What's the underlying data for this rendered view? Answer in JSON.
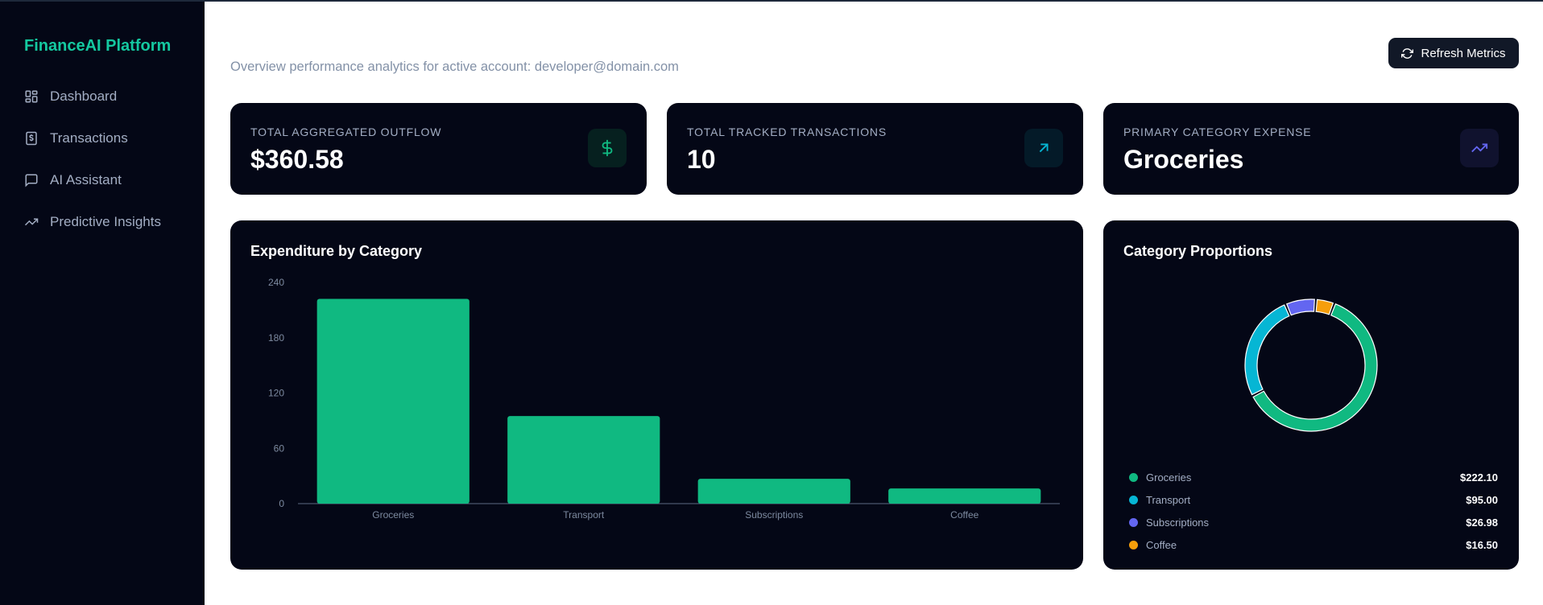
{
  "sidebar": {
    "brand": "FinanceAI Platform",
    "items": [
      {
        "label": "Dashboard",
        "icon": "dashboard-grid-icon"
      },
      {
        "label": "Transactions",
        "icon": "receipt-dollar-icon"
      },
      {
        "label": "AI Assistant",
        "icon": "chat-bubble-icon"
      },
      {
        "label": "Predictive Insights",
        "icon": "trending-up-icon"
      }
    ]
  },
  "header": {
    "subtitle": "Overview performance analytics for active account: developer@domain.com",
    "refresh_label": "Refresh Metrics",
    "refresh_icon": "refresh-icon"
  },
  "stats": [
    {
      "label": "TOTAL AGGREGATED OUTFLOW",
      "value": "$360.58",
      "icon": "dollar-icon",
      "icon_color": "#10b981",
      "icon_bg": "#06201f"
    },
    {
      "label": "TOTAL TRACKED TRANSACTIONS",
      "value": "10",
      "icon": "arrow-up-right-icon",
      "icon_color": "#06b6d4",
      "icon_bg": "#041a28"
    },
    {
      "label": "PRIMARY CATEGORY EXPENSE",
      "value": "Groceries",
      "icon": "trending-up-icon",
      "icon_color": "#6366f1",
      "icon_bg": "#10122e"
    }
  ],
  "bar_card": {
    "title": "Expenditure by Category"
  },
  "pie_card": {
    "title": "Category Proportions"
  },
  "colors": {
    "Groceries": "#10b981",
    "Transport": "#06b6d4",
    "Subscriptions": "#6366f1",
    "Coffee": "#f59e0b"
  },
  "legend": [
    {
      "name": "Groceries",
      "value": "$222.10"
    },
    {
      "name": "Transport",
      "value": "$95.00"
    },
    {
      "name": "Subscriptions",
      "value": "$26.98"
    },
    {
      "name": "Coffee",
      "value": "$16.50"
    }
  ],
  "chart_data": [
    {
      "type": "bar",
      "title": "Expenditure by Category",
      "categories": [
        "Groceries",
        "Transport",
        "Subscriptions",
        "Coffee"
      ],
      "values": [
        222.1,
        95.0,
        26.98,
        16.5
      ],
      "yticks": [
        0,
        60,
        120,
        180,
        240
      ],
      "ylim": [
        0,
        240
      ],
      "bar_color": "#10b981",
      "grid": false
    },
    {
      "type": "pie",
      "title": "Category Proportions",
      "labels": [
        "Groceries",
        "Transport",
        "Subscriptions",
        "Coffee"
      ],
      "values": [
        222.1,
        95.0,
        26.98,
        16.5
      ],
      "donut": true
    }
  ]
}
